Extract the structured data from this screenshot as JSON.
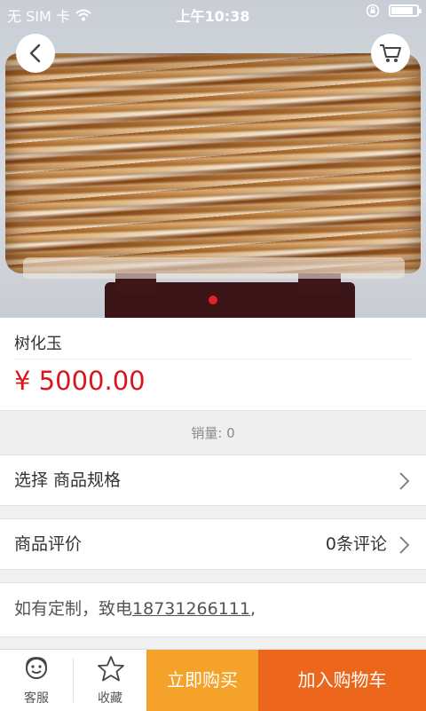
{
  "status_bar": {
    "carrier": "无 SIM 卡",
    "time": "上午10:38",
    "battery_level": 0.85
  },
  "header": {
    "back_icon": "chevron-left-icon",
    "cart_icon": "shopping-cart-icon"
  },
  "gallery": {
    "image_description_alt": "",
    "indicator_active_index": 0,
    "indicator_count": 1
  },
  "product": {
    "title": "树化玉",
    "price": "¥ 5000.00",
    "sales": "销量: 0"
  },
  "spec_row": {
    "label": "选择 商品规格"
  },
  "review_row": {
    "label": "商品评价",
    "count": "0条评论"
  },
  "custom": {
    "prefix": "如有定制，致电",
    "phone": "18731266111",
    "suffix": ","
  },
  "bottom_bar": {
    "service_label": "客服",
    "favorite_label": "收藏",
    "buy_now_label": "立即购买",
    "add_cart_label": "加入购物车"
  },
  "colors": {
    "price": "#d9161c",
    "buy_now": "#f5a22a",
    "add_cart": "#ec661c",
    "indicator": "#e8202a"
  }
}
